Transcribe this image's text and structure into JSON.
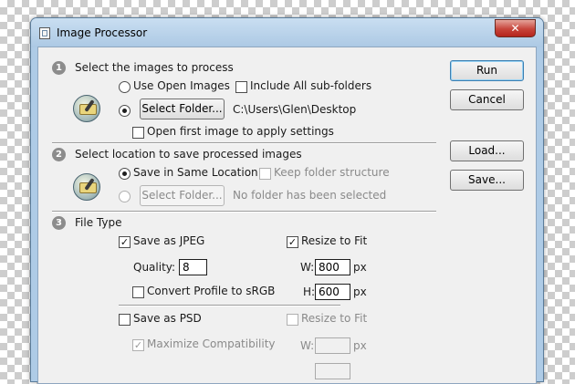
{
  "window": {
    "title": "Image Processor",
    "close_glyph": "✕"
  },
  "section1": {
    "number": "1",
    "title": "Select the images to process",
    "use_open_images": "Use Open Images",
    "include_subfolders": "Include All sub-folders",
    "select_folder": "Select Folder...",
    "folder_path": "C:\\Users\\Glen\\Desktop",
    "open_first_image": "Open first image to apply settings"
  },
  "section2": {
    "number": "2",
    "title": "Select location to save processed images",
    "save_same_location": "Save in Same Location",
    "keep_structure": "Keep folder structure",
    "select_folder": "Select Folder...",
    "no_folder": "No folder has been selected"
  },
  "section3": {
    "number": "3",
    "title": "File Type",
    "save_jpeg": "Save as JPEG",
    "resize_to_fit": "Resize to Fit",
    "quality_label": "Quality:",
    "quality_value": "8",
    "w_label": "W:",
    "h_label": "H:",
    "w_value": "800",
    "h_value": "600",
    "px": "px",
    "convert_profile": "Convert Profile to sRGB",
    "save_psd": "Save as PSD",
    "psd_resize_to_fit": "Resize to Fit",
    "maximize_compat": "Maximize Compatibility",
    "psd_w_label": "W:",
    "psd_w_value": "",
    "psd_px": "px"
  },
  "buttons": {
    "run": "Run",
    "cancel": "Cancel",
    "load": "Load...",
    "save": "Save..."
  },
  "glyphs": {
    "check": "✓"
  }
}
